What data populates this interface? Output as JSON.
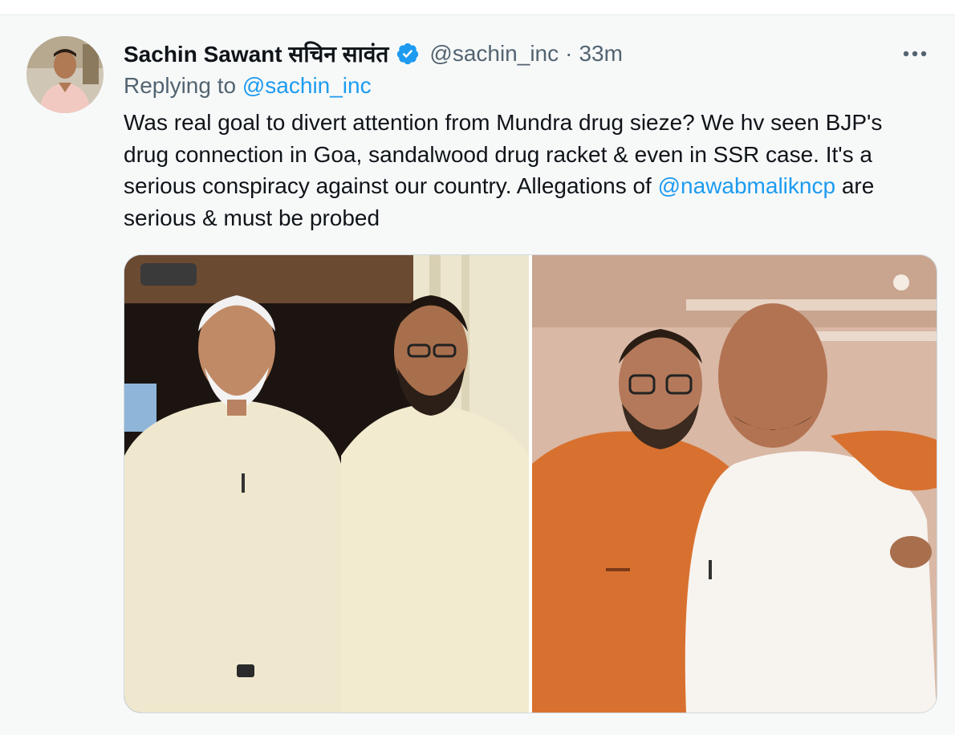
{
  "tweet": {
    "display_name": "Sachin Sawant सचिन सावंत",
    "handle": "@sachin_inc",
    "separator": "·",
    "time": "33m",
    "replying_prefix": "Replying to",
    "replying_to": "@sachin_inc",
    "text_line1": "Was real goal to divert attention from Mundra drug sieze? We hv seen BJP's",
    "text_line2": "drug connection in Goa, sandalwood drug racket & even in SSR case. It's a",
    "text_line3_before": "serious conspiracy against our country. Allegations of ",
    "text_line3_mention": "@nawabmalikncp",
    "text_line3_after": " are",
    "text_line4": "serious & must be probed"
  },
  "icons": {
    "verified": "verified-badge-icon",
    "more": "more-options-icon"
  },
  "colors": {
    "link": "#1d9bf0",
    "secondary_text": "#536471",
    "primary_text": "#0f1419",
    "verified": "#1d9bf0",
    "background": "#f7f9f9"
  }
}
